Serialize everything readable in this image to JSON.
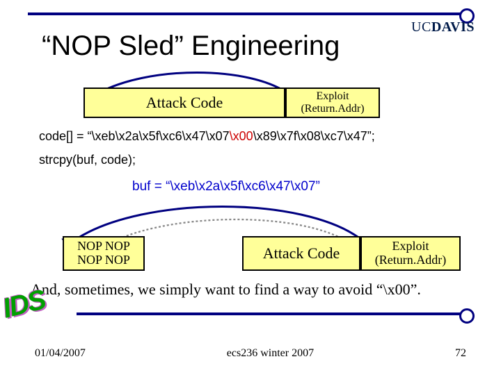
{
  "logo": {
    "uc": "UC",
    "davis": "DAVIS"
  },
  "title": "“NOP Sled” Engineering",
  "row1": {
    "attack": "Attack Code",
    "exploit_line1": "Exploit",
    "exploit_line2": "(Return.Addr)"
  },
  "code": {
    "assign_pre": "code[] = “\\xeb\\x2a\\x5f\\xc6\\x47\\x07",
    "assign_red": "\\x00",
    "assign_post": "\\x89\\x7f\\x08\\xc7\\x47”;",
    "strcpy": "strcpy(buf, code);"
  },
  "bufline": "buf = “\\xeb\\x2a\\x5f\\xc6\\x47\\x07”",
  "row2": {
    "nop_line1": "NOP NOP",
    "nop_line2": "NOP NOP",
    "attack": "Attack Code",
    "exploit_line1": "Exploit",
    "exploit_line2": "(Return.Addr)"
  },
  "conclude": "And, sometimes, we simply want to find a way to avoid “\\x00”.",
  "ids": "IDS",
  "footer": {
    "date": "01/04/2007",
    "course": "ecs236 winter 2007",
    "page": "72"
  }
}
